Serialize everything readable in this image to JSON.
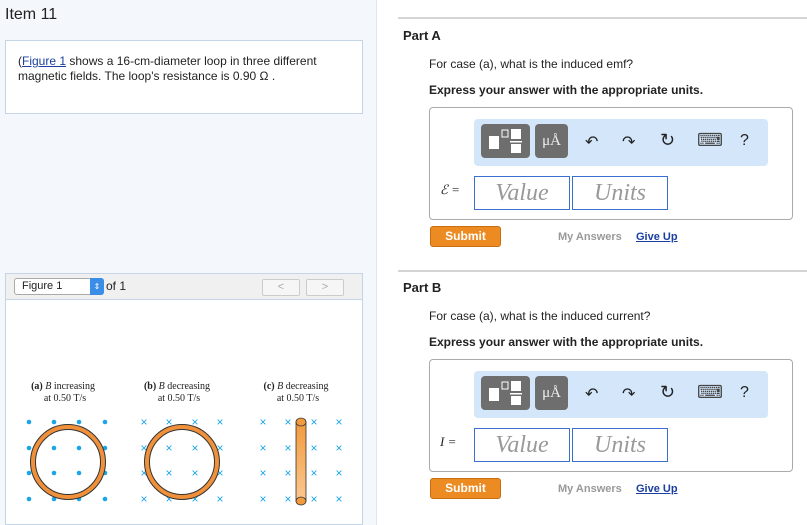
{
  "item_title": "Item 11",
  "problem": {
    "link": "Figure 1",
    "text": " shows a 16-cm-diameter loop in three different magnetic fields. The loop's resistance is 0.90 Ω ."
  },
  "figure": {
    "selector": "Figure 1",
    "of": "of 1",
    "prev": "<",
    "next": ">",
    "captions": [
      {
        "label": "(a) ",
        "var": "B",
        "rest": " increasing",
        "rate": "at 0.50 T/s"
      },
      {
        "label": "(b) ",
        "var": "B",
        "rest": " decreasing",
        "rate": "at 0.50 T/s"
      },
      {
        "label": "(c) ",
        "var": "B",
        "rest": " decreasing",
        "rate": "at 0.50 T/s"
      }
    ]
  },
  "toolbar": {
    "templates": "▪▫",
    "units": "μÅ",
    "undo": "↶",
    "redo": "↷",
    "reset": "↻",
    "keyboard": "⌨",
    "help": "?"
  },
  "parts": [
    {
      "title": "Part A",
      "question": "For case (a), what is the induced emf?",
      "express": "Express your answer with the appropriate units.",
      "var_label": "ℰ =",
      "value_placeholder": "Value",
      "units_placeholder": "Units",
      "submit": "Submit",
      "my_answers": "My Answers",
      "give_up": "Give Up"
    },
    {
      "title": "Part B",
      "question": "For case (a), what is the induced current?",
      "express": "Express your answer with the appropriate units.",
      "var_label": "I =",
      "value_placeholder": "Value",
      "units_placeholder": "Units",
      "submit": "Submit",
      "my_answers": "My Answers",
      "give_up": "Give Up"
    }
  ]
}
